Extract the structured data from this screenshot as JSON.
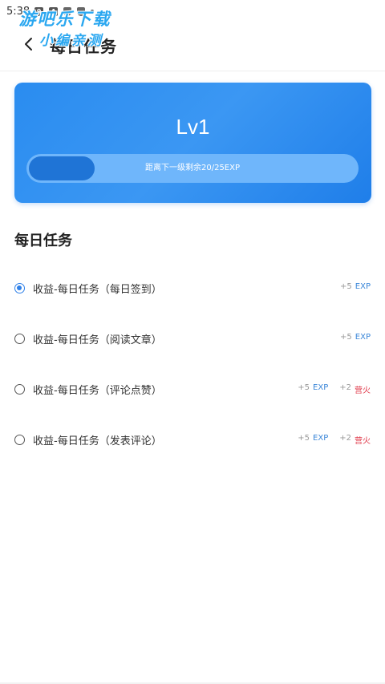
{
  "status_bar": {
    "time": "5:38"
  },
  "watermark": {
    "line1": "游吧乐下载",
    "line2": "小编亲测"
  },
  "header": {
    "title": "每日任务",
    "back_icon": "chevron-left-icon"
  },
  "level_card": {
    "level": "Lv1",
    "progress_text": "距离下一级剩余20/25EXP",
    "progress_fraction": 0.2,
    "gradient_start": "#2a8cf0",
    "gradient_end": "#1f7ee9"
  },
  "section": {
    "title": "每日任务"
  },
  "tasks": [
    {
      "label": "收益-每日任务（每日签到）",
      "checked": true,
      "rewards": [
        {
          "amount": "+5",
          "unit": "EXP"
        }
      ]
    },
    {
      "label": "收益-每日任务（阅读文章）",
      "checked": false,
      "rewards": [
        {
          "amount": "+5",
          "unit": "EXP"
        }
      ]
    },
    {
      "label": "收益-每日任务（评论点赞）",
      "checked": false,
      "rewards": [
        {
          "amount": "+5",
          "unit": "EXP"
        },
        {
          "amount": "+2",
          "unit": "营火"
        }
      ]
    },
    {
      "label": "收益-每日任务（发表评论）",
      "checked": false,
      "rewards": [
        {
          "amount": "+5",
          "unit": "EXP"
        },
        {
          "amount": "+2",
          "unit": "营火"
        }
      ]
    }
  ],
  "colors": {
    "accent": "#2f80e8",
    "exp": "#3a86d8",
    "fire": "#e0394a"
  }
}
